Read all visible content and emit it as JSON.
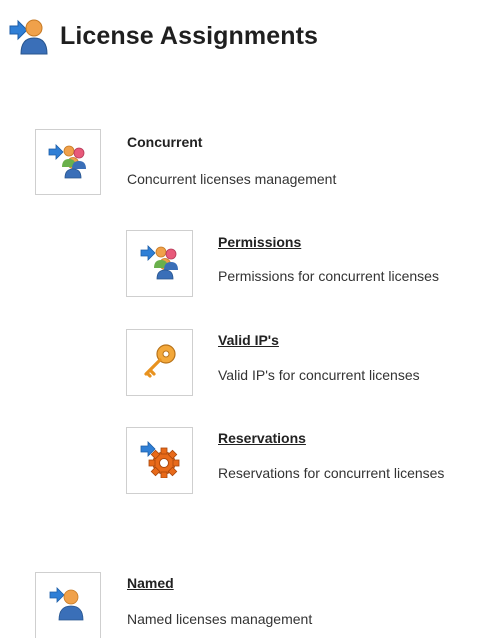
{
  "header": {
    "title": "License Assignments",
    "icon": "user-arrow-icon"
  },
  "items": {
    "concurrent": {
      "title": "Concurrent",
      "description": "Concurrent licenses management",
      "icon": "group-arrow-icon",
      "is_link": false
    },
    "permissions": {
      "title": "Permissions",
      "description": "Permissions for concurrent licenses",
      "icon": "group-arrow-icon",
      "is_link": true
    },
    "valid_ips": {
      "title": "Valid IP's",
      "description": "Valid IP's for concurrent licenses",
      "icon": "key-icon",
      "is_link": true
    },
    "reservations": {
      "title": "Reservations",
      "description": "Reservations for concurrent licenses",
      "icon": "gear-arrow-icon",
      "is_link": true
    },
    "named": {
      "title": "Named",
      "description": "Named licenses management",
      "icon": "user-arrow-icon",
      "is_link": true
    }
  },
  "colors": {
    "arrow": "#2f7fd6",
    "user_orange": "#f0a14a",
    "user_blue": "#3a6fb8",
    "key": "#e8921f",
    "gear": "#e86a1a"
  }
}
